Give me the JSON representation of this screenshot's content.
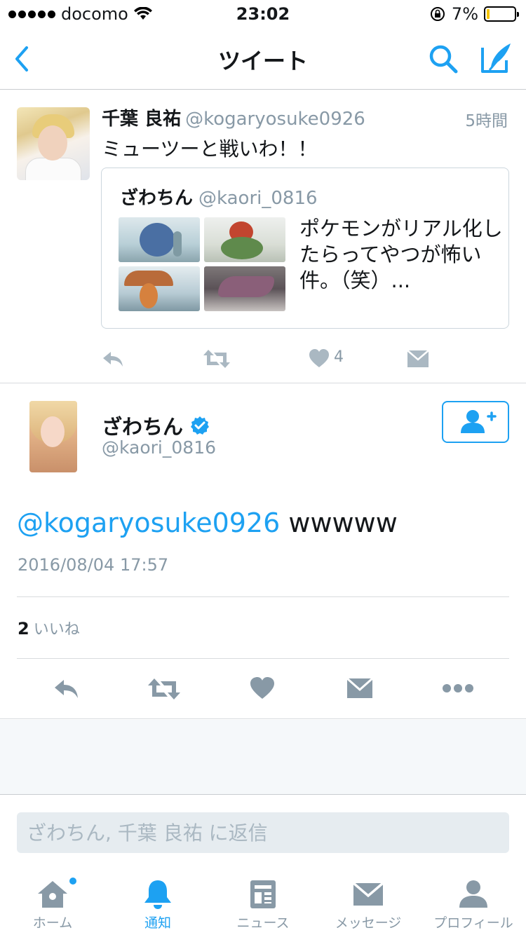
{
  "status_bar": {
    "carrier": "docomo",
    "time": "23:02",
    "battery": "7%"
  },
  "nav": {
    "title": "ツイート"
  },
  "quoted_parent": {
    "name": "千葉 良祐",
    "handle": "@kogaryosuke0926",
    "time": "5時間",
    "text": "ミューツーと戦いわ！！",
    "likes": "4",
    "quote": {
      "name": "ざわちん",
      "handle": "@kaori_0816",
      "text": "ポケモンがリアル化したらってやつが怖い件。（笑）..."
    }
  },
  "detail": {
    "name": "ざわちん",
    "handle": "@kaori_0816",
    "mention": "@kogaryosuke0926",
    "text_rest": " wwwww",
    "date": "2016/08/04 17:57",
    "like_count": "2",
    "like_label": "いいね"
  },
  "reply": {
    "placeholder": "ざわちん, 千葉 良祐 に返信"
  },
  "tabs": [
    {
      "label": "ホーム",
      "icon": "home-icon"
    },
    {
      "label": "通知",
      "icon": "bell-icon",
      "active": true
    },
    {
      "label": "ニュース",
      "icon": "news-icon"
    },
    {
      "label": "メッセージ",
      "icon": "message-icon"
    },
    {
      "label": "プロフィール",
      "icon": "profile-icon"
    }
  ],
  "colors": {
    "accent": "#1da1f2",
    "muted": "#8899a6",
    "text": "#14171a"
  }
}
